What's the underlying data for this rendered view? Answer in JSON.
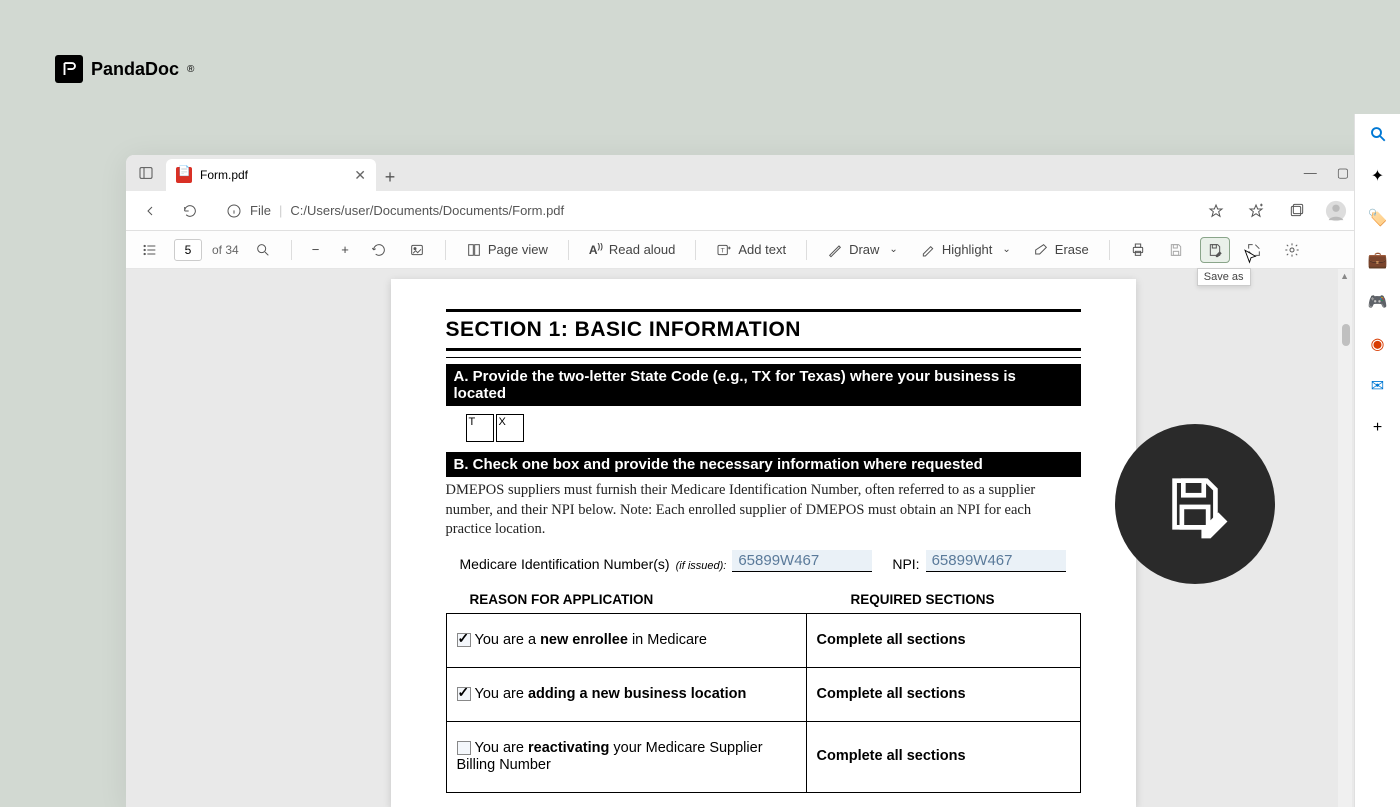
{
  "brand": "PandaDoc",
  "tab": {
    "title": "Form.pdf"
  },
  "address": {
    "scheme_label": "File",
    "path": "C:/Users/user/Documents/Documents/Form.pdf"
  },
  "window": {
    "min": "—",
    "max": "▢",
    "close": "✕"
  },
  "pdf_bar": {
    "page_current": "5",
    "page_total": "of 34",
    "page_view": "Page view",
    "read_aloud": "Read aloud",
    "add_text": "Add text",
    "draw": "Draw",
    "highlight": "Highlight",
    "erase": "Erase",
    "save_as_tooltip": "Save as"
  },
  "doc": {
    "section_title": "SECTION 1:   BASIC INFORMATION",
    "bar_a": "A. Provide the two-letter State Code (e.g., TX for Texas) where your business is located",
    "state_1": "T",
    "state_2": "X",
    "bar_b": "B. Check one box and provide the necessary information where requested",
    "para_b": "DMEPOS suppliers must furnish their Medicare Identification Number, often referred to as a supplier number, and their NPI below. Note: Each enrolled supplier of DMEPOS must obtain an NPI for each practice location.",
    "mid_label": "Medicare Identification Number(s)",
    "mid_sub": "(if issued):",
    "mid_value": "65899W467",
    "npi_label": "NPI:",
    "npi_value": "65899W467",
    "col_reason": "REASON FOR APPLICATION",
    "col_required": "REQUIRED SECTIONS",
    "rows": [
      {
        "pre": "You are a ",
        "bold": "new enrollee",
        "post": " in Medicare",
        "req": "Complete all sections",
        "checked": true
      },
      {
        "pre": "You are ",
        "bold": "adding a new business location",
        "post": "",
        "req": "Complete all sections",
        "checked": true
      },
      {
        "pre": "You are ",
        "bold": "reactivating",
        "post": " your Medicare Supplier Billing Number",
        "req": "Complete all sections",
        "checked": false
      }
    ]
  }
}
